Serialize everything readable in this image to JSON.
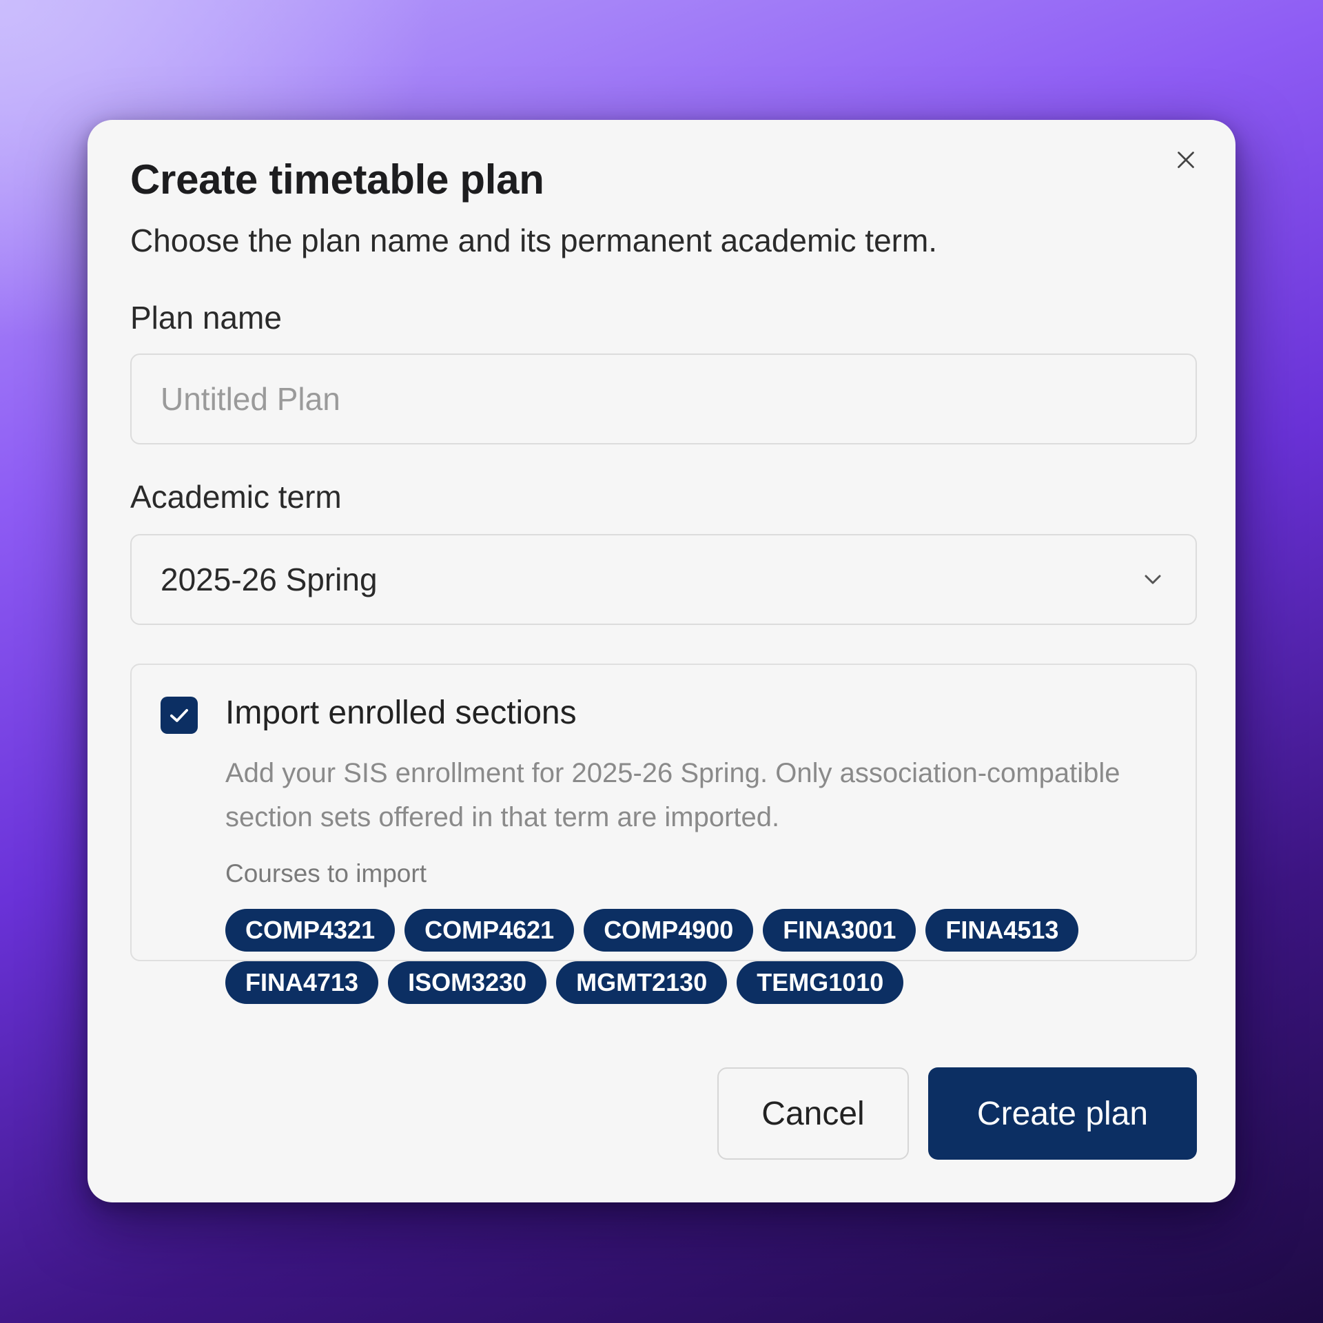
{
  "dialog": {
    "title": "Create timetable plan",
    "subtitle": "Choose the plan name and its permanent academic term.",
    "close_icon": "close-icon"
  },
  "plan_name": {
    "label": "Plan name",
    "value": "",
    "placeholder": "Untitled Plan"
  },
  "academic_term": {
    "label": "Academic term",
    "selected": "2025-26 Spring",
    "icon": "chevron-down-icon"
  },
  "import": {
    "checked": true,
    "label": "Import enrolled sections",
    "help_text": "Add your SIS enrollment for 2025-26 Spring. Only association-compatible section sets offered in that term are imported.",
    "courses_label": "Courses to import",
    "courses_row1": [
      "COMP4321",
      "COMP4621",
      "COMP4900",
      "FINA3001",
      "FINA4513"
    ],
    "courses_row2": [
      "FINA4713",
      "ISOM3230",
      "MGMT2130",
      "TEMG1010"
    ]
  },
  "actions": {
    "cancel_label": "Cancel",
    "create_label": "Create plan"
  },
  "colors": {
    "primary": "#0c2f63",
    "dialog_bg": "#f6f6f6",
    "background_gradient_start": "#b9a4fb",
    "background_gradient_end": "#1e0a44"
  }
}
